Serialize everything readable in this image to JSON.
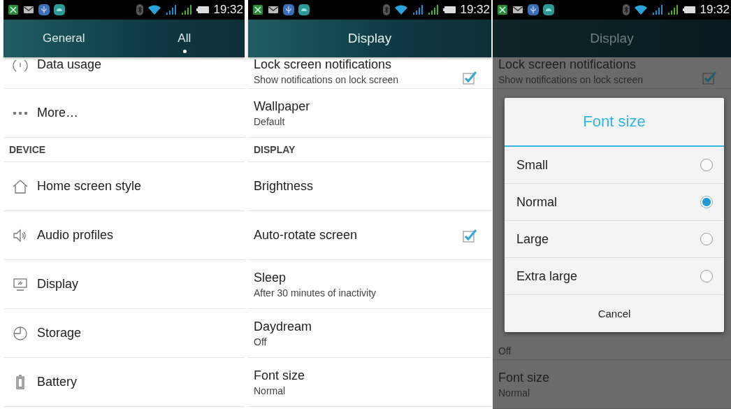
{
  "screens": [
    {
      "kind": "tabbed",
      "status_bar": {
        "time": "19:32"
      },
      "tabs": [
        {
          "label": "General",
          "selected": false
        },
        {
          "label": "All",
          "selected": true
        }
      ],
      "items": [
        {
          "kind": "icon_row",
          "title": "Data usage"
        },
        {
          "kind": "icon_row",
          "title": "More…"
        },
        {
          "kind": "header",
          "title": "DEVICE"
        },
        {
          "kind": "icon_row",
          "title": "Home screen style"
        },
        {
          "kind": "icon_row",
          "title": "Audio profiles"
        },
        {
          "kind": "icon_row",
          "title": "Display"
        },
        {
          "kind": "icon_row",
          "title": "Storage"
        },
        {
          "kind": "icon_row",
          "title": "Battery"
        }
      ]
    },
    {
      "kind": "titled",
      "status_bar": {
        "time": "19:32"
      },
      "title": "Display",
      "items": [
        {
          "kind": "checkbox",
          "title": "Lock screen notifications",
          "subtitle": "Show notifications on lock screen",
          "checked": true
        },
        {
          "kind": "setting",
          "title": "Wallpaper",
          "subtitle": "Default"
        },
        {
          "kind": "header",
          "title": "DISPLAY"
        },
        {
          "kind": "setting",
          "title": "Brightness"
        },
        {
          "kind": "checkbox",
          "title": "Auto-rotate screen",
          "checked": true
        },
        {
          "kind": "setting",
          "title": "Sleep",
          "subtitle": "After 30 minutes of inactivity"
        },
        {
          "kind": "setting",
          "title": "Daydream",
          "subtitle": "Off"
        },
        {
          "kind": "setting",
          "title": "Font size",
          "subtitle": "Normal"
        }
      ]
    },
    {
      "kind": "dialog",
      "status_bar": {
        "time": "19:32"
      },
      "title": "Display",
      "items": [
        {
          "kind": "checkbox",
          "title": "Lock screen notifications",
          "subtitle": "Show notifications on lock screen",
          "checked": true
        },
        {
          "kind": "setting",
          "subtitle": "Off"
        },
        {
          "kind": "setting",
          "title": "Font size",
          "subtitle": "Normal"
        }
      ],
      "dialog": {
        "title": "Font size",
        "options": [
          {
            "label": "Small",
            "selected": false
          },
          {
            "label": "Normal",
            "selected": true
          },
          {
            "label": "Large",
            "selected": false
          },
          {
            "label": "Extra large",
            "selected": false
          }
        ],
        "cancel": "Cancel"
      }
    }
  ]
}
